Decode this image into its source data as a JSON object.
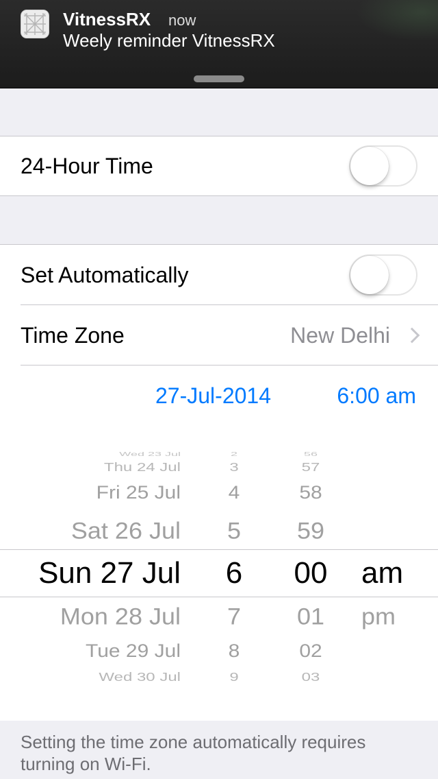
{
  "notification": {
    "app_name": "VitnessRX",
    "time": "now",
    "message": "Weely reminder VitnessRX"
  },
  "settings": {
    "hour24": {
      "label": "24-Hour Time",
      "on": false
    },
    "set_auto": {
      "label": "Set Automatically",
      "on": false
    },
    "time_zone": {
      "label": "Time Zone",
      "value": "New Delhi"
    },
    "date": "27-Jul-2014",
    "time": "6:00 am"
  },
  "picker": {
    "days": [
      "Wed 23 Jul",
      "Thu 24 Jul",
      "Fri 25 Jul",
      "Sat 26 Jul",
      "Sun 27 Jul",
      "Mon 28 Jul",
      "Tue 29 Jul",
      "Wed 30 Jul"
    ],
    "hours": [
      "2",
      "3",
      "4",
      "5",
      "6",
      "7",
      "8",
      "9"
    ],
    "minutes": [
      "56",
      "57",
      "58",
      "59",
      "00",
      "01",
      "02",
      "03"
    ],
    "ampm": [
      "am",
      "pm"
    ],
    "selected_index": 4
  },
  "colors": {
    "accent": "#007aff",
    "secondary": "#8e8e93",
    "background": "#efeff4"
  },
  "footer": "Setting the time zone automatically requires turning on Wi-Fi."
}
